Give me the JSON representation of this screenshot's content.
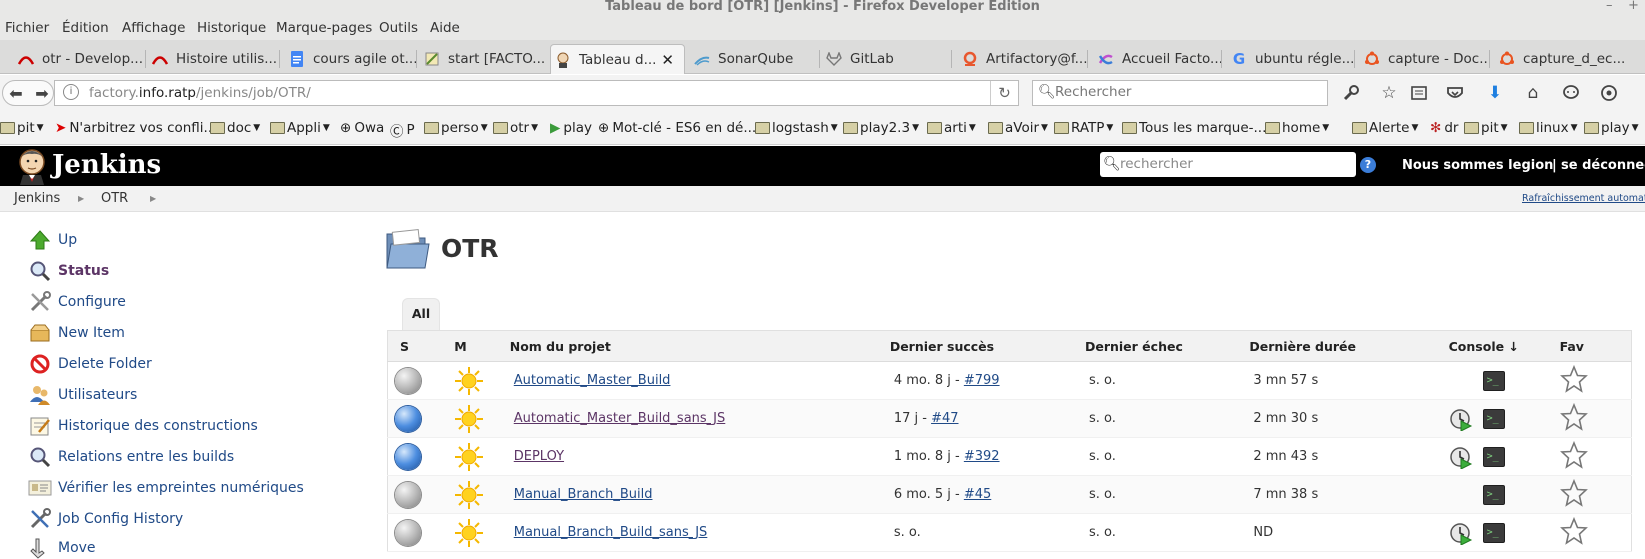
{
  "window": {
    "title": "Tableau de bord [OTR] [Jenkins] - Firefox Developer Edition",
    "minimize": "–",
    "maximize": "+"
  },
  "menu": [
    "Fichier",
    "Édition",
    "Affichage",
    "Historique",
    "Marque-pages",
    "Outils",
    "Aide"
  ],
  "tabs": [
    {
      "label": "otr - Develop...",
      "icon": "redhat-icon",
      "color": "#cc0000"
    },
    {
      "label": "Histoire utilis...",
      "icon": "redhat-icon",
      "color": "#cc0000"
    },
    {
      "label": "cours agile ot...",
      "icon": "google-docs-icon",
      "color": "#4285f4"
    },
    {
      "label": "start [FACTO...",
      "icon": "dokuwiki-icon",
      "color": "#5a8b2e"
    },
    {
      "label": "Tableau d...",
      "icon": "jenkins-icon",
      "color": "#b5713a",
      "active": true
    },
    {
      "label": "SonarQube",
      "icon": "sonarqube-icon",
      "color": "#4e9bcd"
    },
    {
      "label": "GitLab",
      "icon": "gitlab-icon",
      "color": "#777777"
    },
    {
      "label": "Artifactory@f...",
      "icon": "artifactory-icon",
      "color": "#e8572e"
    },
    {
      "label": "Accueil Facto...",
      "icon": "confluence-icon",
      "color": "#c04fcf"
    },
    {
      "label": "ubuntu régle...",
      "icon": "google-icon",
      "color": "#4285f4"
    },
    {
      "label": "capture - Doc...",
      "icon": "ubuntu-icon",
      "color": "#e95420"
    },
    {
      "label": "capture_d_ec...",
      "icon": "ubuntu-icon",
      "color": "#e95420"
    }
  ],
  "nav": {
    "url_prefix": "factory.",
    "url_domain": "info.ratp",
    "url_path": "/jenkins/job/OTR/",
    "search_placeholder": "Rechercher"
  },
  "bookmarks": [
    {
      "label": "pit",
      "type": "folder"
    },
    {
      "label": "N'arbitrez vos confli...",
      "type": "link"
    },
    {
      "label": "doc",
      "type": "folder"
    },
    {
      "label": "Appli",
      "type": "folder"
    },
    {
      "label": "Owa",
      "type": "link"
    },
    {
      "label": "P",
      "type": "link"
    },
    {
      "label": "perso",
      "type": "folder"
    },
    {
      "label": "otr",
      "type": "folder"
    },
    {
      "label": "play",
      "type": "link"
    },
    {
      "label": "Mot-clé - ES6 en dé...",
      "type": "link"
    },
    {
      "label": "logstash",
      "type": "folder"
    },
    {
      "label": "play2.3",
      "type": "folder"
    },
    {
      "label": "arti",
      "type": "folder"
    },
    {
      "label": "aVoir",
      "type": "folder"
    },
    {
      "label": "RATP",
      "type": "folder"
    },
    {
      "label": "Tous les marque-...",
      "type": "folder"
    },
    {
      "label": "home",
      "type": "folder"
    },
    {
      "label": "Alerte",
      "type": "folder"
    },
    {
      "label": "dr",
      "type": "link"
    },
    {
      "label": "pit",
      "type": "folder"
    },
    {
      "label": "linux",
      "type": "folder"
    },
    {
      "label": "play",
      "type": "folder"
    }
  ],
  "jenkins": {
    "title": "Jenkins",
    "search_placeholder": "rechercher",
    "help": "?",
    "user": "Nous sommes legion",
    "separator": "|",
    "logout": "se déconnecter",
    "auto_refresh": "Rafraîchissement automatique"
  },
  "breadcrumb": [
    "Jenkins",
    "OTR"
  ],
  "side_menu": [
    {
      "label": "Up",
      "icon": "up-arrow-icon"
    },
    {
      "label": "Status",
      "icon": "magnifier-icon",
      "current": true
    },
    {
      "label": "Configure",
      "icon": "configure-tools-icon"
    },
    {
      "label": "New Item",
      "icon": "new-package-icon"
    },
    {
      "label": "Delete Folder",
      "icon": "no-entry-icon"
    },
    {
      "label": "Utilisateurs",
      "icon": "users-icon"
    },
    {
      "label": "Historique des constructions",
      "icon": "notepad-icon"
    },
    {
      "label": "Relations entre les builds",
      "icon": "magnifier-icon"
    },
    {
      "label": "Vérifier les empreintes numériques",
      "icon": "fingerprint-icon"
    },
    {
      "label": "Job Config History",
      "icon": "tools-icon"
    },
    {
      "label": "Move",
      "icon": "move-icon"
    }
  ],
  "main": {
    "title": "OTR",
    "view_tab": "All",
    "columns": [
      "S",
      "M",
      "Nom du projet",
      "Dernier succès",
      "Dernier échec",
      "Dernière durée",
      "Console ↓",
      "Fav"
    ],
    "jobs": [
      {
        "status": "grey",
        "weather": "sunny",
        "name": "Automatic_Master_Build",
        "success_age": "4 mo. 8 j - ",
        "success_build": "#799",
        "failure": "s. o.",
        "duration": "3 mn 57 s",
        "scheduled": false,
        "visited": false
      },
      {
        "status": "blue",
        "weather": "sunny",
        "name": "Automatic_Master_Build_sans_JS",
        "success_age": "17 j - ",
        "success_build": "#47",
        "failure": "s. o.",
        "duration": "2 mn 30 s",
        "scheduled": true,
        "visited": true
      },
      {
        "status": "blue",
        "weather": "sunny",
        "name": "DEPLOY",
        "success_age": "1 mo. 8 j - ",
        "success_build": "#392",
        "failure": "s. o.",
        "duration": "2 mn 43 s",
        "scheduled": true,
        "visited": true
      },
      {
        "status": "grey",
        "weather": "sunny",
        "name": "Manual_Branch_Build",
        "success_age": "6 mo. 5 j - ",
        "success_build": "#45",
        "failure": "s. o.",
        "duration": "7 mn 38 s",
        "scheduled": false,
        "visited": false
      },
      {
        "status": "grey",
        "weather": "sunny",
        "name": "Manual_Branch_Build_sans_JS",
        "success_age": "s. o.",
        "success_build": "",
        "failure": "s. o.",
        "duration": "ND",
        "scheduled": true,
        "visited": false
      }
    ]
  }
}
